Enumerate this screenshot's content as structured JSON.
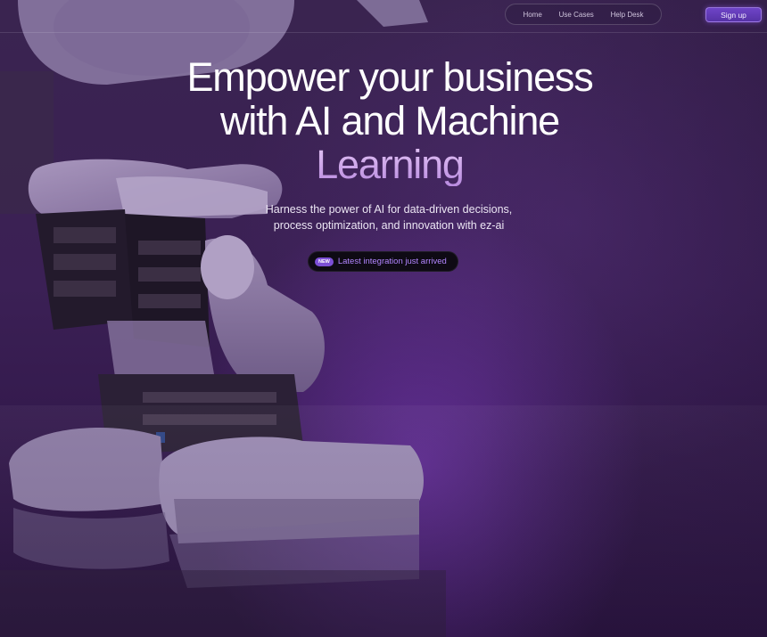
{
  "nav": {
    "links": [
      "Home",
      "Use Cases",
      "Help Desk"
    ],
    "signup_label": "Sign up"
  },
  "hero": {
    "title_line1": "Empower your business",
    "title_line2": "with AI and Machine",
    "title_accent": "Learning",
    "subtitle_line1": "Harness the power of AI for data-driven decisions,",
    "subtitle_line2": "process optimization, and innovation with ez-ai",
    "badge_tag": "NEW",
    "badge_text": "Latest integration just arrived"
  },
  "colors": {
    "accent": "#7c4fd6",
    "background": "#3b2055",
    "title_accent": "#c99de8"
  }
}
